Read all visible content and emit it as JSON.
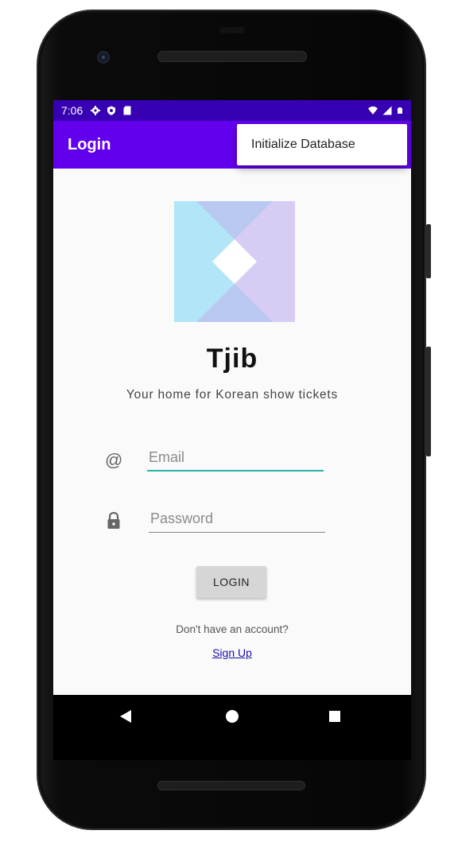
{
  "status_bar": {
    "time": "7:06",
    "left_icons": [
      "settings-icon",
      "shield-icon",
      "sd-card-icon"
    ],
    "right_icons": [
      "wifi-icon",
      "signal-icon",
      "battery-icon"
    ]
  },
  "app_bar": {
    "title": "Login"
  },
  "overflow_menu": {
    "items": [
      {
        "label": "Initialize Database"
      }
    ]
  },
  "branding": {
    "app_name": "Tjib",
    "tagline": "Your home for Korean show tickets"
  },
  "form": {
    "email": {
      "icon": "at-icon",
      "placeholder": "Email",
      "value": ""
    },
    "password": {
      "icon": "lock-icon",
      "placeholder": "Password",
      "value": ""
    },
    "login_label": "LOGIN",
    "signup_prompt": "Don't have an account?",
    "signup_link": "Sign Up"
  },
  "colors": {
    "status_bar": "#3700b3",
    "app_bar": "#6200ee",
    "input_accent": "#26b5a6",
    "logo_blue": "#b3e5f8",
    "logo_purple": "#d7cdf4"
  },
  "nav_bar": {
    "buttons": [
      "back-icon",
      "home-icon",
      "recents-icon"
    ]
  }
}
